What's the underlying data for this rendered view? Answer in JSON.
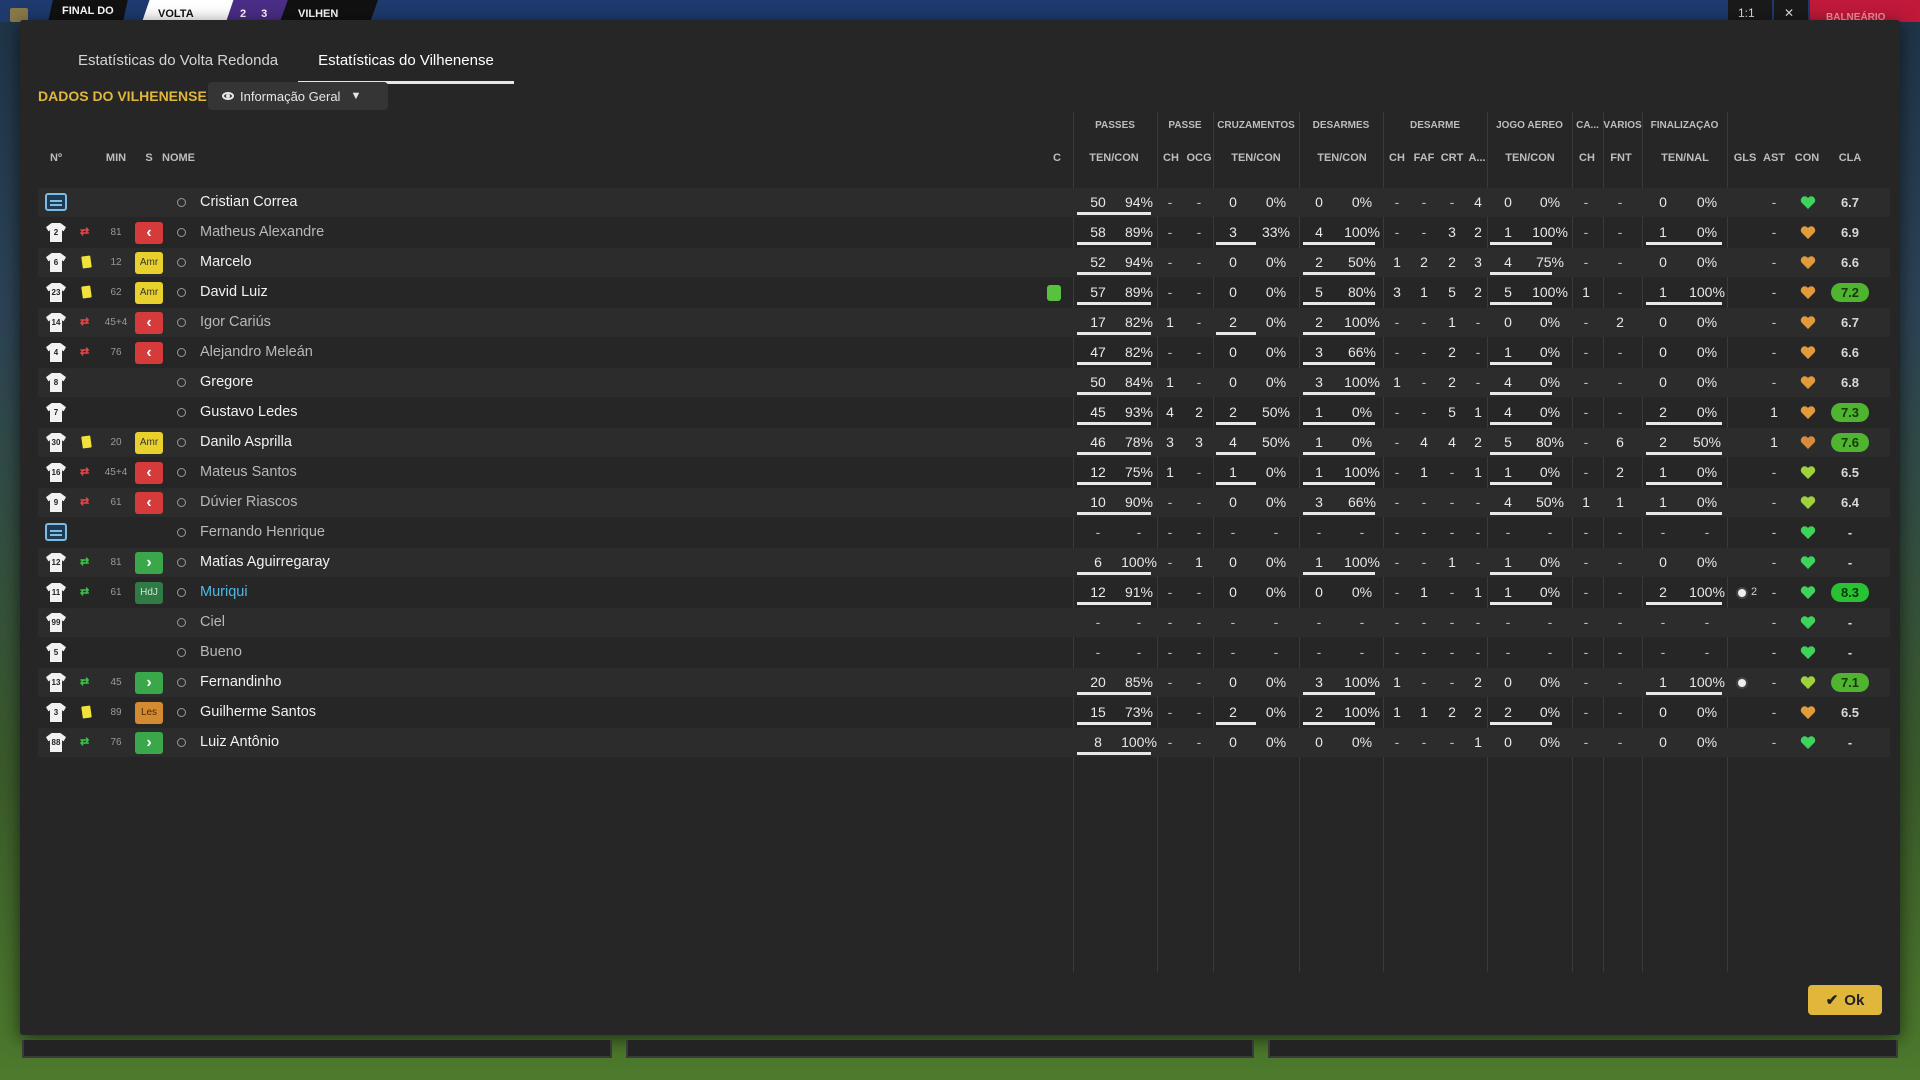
{
  "scoreboard": {
    "status": "FINAL DO",
    "home": "VOLTA",
    "score": "2 3",
    "away": "VILHEN",
    "controls": [
      "1:1",
      "✕"
    ],
    "balneario": "BALNEÁRIO"
  },
  "tabs": [
    {
      "label": "Estatísticas do Volta Redonda",
      "active": false
    },
    {
      "label": "Estatísticas do Vilhenense",
      "active": true
    }
  ],
  "section_title": "DADOS DO VILHENENSE",
  "view_dropdown": "Informação Geral",
  "group_headers": [
    "PASSES",
    "PASSE",
    "CRUZAMENTOS",
    "DESARMES",
    "DESARME",
    "JOGO AÉREO",
    "CA...",
    "VÁRIOS",
    "FINALIZAÇÃO"
  ],
  "col_headers": {
    "num": "Nº",
    "min": "MIN",
    "s": "S",
    "nome": "NOME",
    "c": "C",
    "passes": "TEN/CON",
    "passe_ch": "CH",
    "passe_ocg": "OCG",
    "cruz": "TEN/CON",
    "desarmes": "TEN/CON",
    "des_ch": "CH",
    "des_faf": "FAF",
    "des_crt": "CRT",
    "des_a": "A...",
    "aereo": "TEN/CON",
    "ca_ch": "CH",
    "fnt": "FNT",
    "fin": "TEN/NAL",
    "gls": "GLS",
    "ast": "AST",
    "con": "CON",
    "cla": "CLA"
  },
  "players": [
    {
      "num": "",
      "bench": true,
      "ev": "",
      "min": "",
      "st": "",
      "name": "Cristian Correa",
      "style": "normal",
      "fit": false,
      "pass": [
        "50",
        "94%"
      ],
      "pch": "-",
      "pocg": "-",
      "cruz": [
        "0",
        "0%"
      ],
      "des": [
        "0",
        "0%"
      ],
      "dch": "-",
      "dfaf": "-",
      "dcrt": "-",
      "da": "4",
      "aer": [
        "0",
        "0%"
      ],
      "cach": "-",
      "fnt": "-",
      "fin": [
        "0",
        "0%"
      ],
      "gls": "",
      "ast": "-",
      "con": "green",
      "cla": "6.7",
      "cla_style": "plain"
    },
    {
      "num": "2",
      "ev": "out",
      "min": "81",
      "st": "out",
      "name": "Matheus Alexandre",
      "style": "dim",
      "fit": false,
      "pass": [
        "58",
        "89%"
      ],
      "pch": "-",
      "pocg": "-",
      "cruz": [
        "3",
        "33%"
      ],
      "des": [
        "4",
        "100%"
      ],
      "dch": "-",
      "dfaf": "-",
      "dcrt": "3",
      "da": "2",
      "aer": [
        "1",
        "100%"
      ],
      "cach": "-",
      "fnt": "-",
      "fin": [
        "1",
        "0%"
      ],
      "gls": "",
      "ast": "-",
      "con": "orange",
      "cla": "6.9",
      "cla_style": "plain"
    },
    {
      "num": "6",
      "ev": "yellow",
      "min": "12",
      "st": "Amr",
      "name": "Marcelo",
      "style": "normal",
      "fit": false,
      "pass": [
        "52",
        "94%"
      ],
      "pch": "-",
      "pocg": "-",
      "cruz": [
        "0",
        "0%"
      ],
      "des": [
        "2",
        "50%"
      ],
      "dch": "1",
      "dfaf": "2",
      "dcrt": "2",
      "da": "3",
      "aer": [
        "4",
        "75%"
      ],
      "cach": "-",
      "fnt": "-",
      "fin": [
        "0",
        "0%"
      ],
      "gls": "",
      "ast": "-",
      "con": "orange",
      "cla": "6.6",
      "cla_style": "plain"
    },
    {
      "num": "23",
      "ev": "yellow",
      "min": "62",
      "st": "Amr",
      "name": "David Luiz",
      "style": "normal",
      "fit": true,
      "pass": [
        "57",
        "89%"
      ],
      "pch": "-",
      "pocg": "-",
      "cruz": [
        "0",
        "0%"
      ],
      "des": [
        "5",
        "80%"
      ],
      "dch": "3",
      "dfaf": "1",
      "dcrt": "5",
      "da": "2",
      "aer": [
        "5",
        "100%"
      ],
      "cach": "1",
      "fnt": "-",
      "fin": [
        "1",
        "100%"
      ],
      "gls": "",
      "ast": "-",
      "con": "orange",
      "cla": "7.2",
      "cla_style": "good"
    },
    {
      "num": "14",
      "ev": "out",
      "min": "45+4",
      "st": "out",
      "name": "Igor Cariús",
      "style": "dim",
      "fit": false,
      "pass": [
        "17",
        "82%"
      ],
      "pch": "1",
      "pocg": "-",
      "cruz": [
        "2",
        "0%"
      ],
      "des": [
        "2",
        "100%"
      ],
      "dch": "-",
      "dfaf": "-",
      "dcrt": "1",
      "da": "-",
      "aer": [
        "0",
        "0%"
      ],
      "cach": "-",
      "fnt": "2",
      "fin": [
        "0",
        "0%"
      ],
      "gls": "",
      "ast": "-",
      "con": "orange",
      "cla": "6.7",
      "cla_style": "plain"
    },
    {
      "num": "4",
      "ev": "out",
      "min": "76",
      "st": "out",
      "name": "Alejandro Meleán",
      "style": "dim",
      "fit": false,
      "pass": [
        "47",
        "82%"
      ],
      "pch": "-",
      "pocg": "-",
      "cruz": [
        "0",
        "0%"
      ],
      "des": [
        "3",
        "66%"
      ],
      "dch": "-",
      "dfaf": "-",
      "dcrt": "2",
      "da": "-",
      "aer": [
        "1",
        "0%"
      ],
      "cach": "-",
      "fnt": "-",
      "fin": [
        "0",
        "0%"
      ],
      "gls": "",
      "ast": "-",
      "con": "orange",
      "cla": "6.6",
      "cla_style": "plain"
    },
    {
      "num": "8",
      "ev": "",
      "min": "",
      "st": "",
      "name": "Gregore",
      "style": "normal",
      "fit": false,
      "pass": [
        "50",
        "84%"
      ],
      "pch": "1",
      "pocg": "-",
      "cruz": [
        "0",
        "0%"
      ],
      "des": [
        "3",
        "100%"
      ],
      "dch": "1",
      "dfaf": "-",
      "dcrt": "2",
      "da": "-",
      "aer": [
        "4",
        "0%"
      ],
      "cach": "-",
      "fnt": "-",
      "fin": [
        "0",
        "0%"
      ],
      "gls": "",
      "ast": "-",
      "con": "orange",
      "cla": "6.8",
      "cla_style": "plain"
    },
    {
      "num": "7",
      "ev": "",
      "min": "",
      "st": "",
      "name": "Gustavo Ledes",
      "style": "normal",
      "fit": false,
      "pass": [
        "45",
        "93%"
      ],
      "pch": "4",
      "pocg": "2",
      "cruz": [
        "2",
        "50%"
      ],
      "des": [
        "1",
        "0%"
      ],
      "dch": "-",
      "dfaf": "-",
      "dcrt": "5",
      "da": "1",
      "aer": [
        "4",
        "0%"
      ],
      "cach": "-",
      "fnt": "-",
      "fin": [
        "2",
        "0%"
      ],
      "gls": "",
      "ast": "1",
      "con": "orange",
      "cla": "7.3",
      "cla_style": "good"
    },
    {
      "num": "30",
      "ev": "yellow",
      "min": "20",
      "st": "Amr",
      "name": "Danilo Asprilla",
      "style": "normal",
      "fit": false,
      "pass": [
        "46",
        "78%"
      ],
      "pch": "3",
      "pocg": "3",
      "cruz": [
        "4",
        "50%"
      ],
      "des": [
        "1",
        "0%"
      ],
      "dch": "-",
      "dfaf": "4",
      "dcrt": "4",
      "da": "2",
      "aer": [
        "5",
        "80%"
      ],
      "cach": "-",
      "fnt": "6",
      "fin": [
        "2",
        "50%"
      ],
      "gls": "",
      "ast": "1",
      "con": "orange2",
      "cla": "7.6",
      "cla_style": "good"
    },
    {
      "num": "16",
      "ev": "out",
      "min": "45+4",
      "st": "out",
      "name": "Mateus Santos",
      "style": "dim",
      "fit": false,
      "pass": [
        "12",
        "75%"
      ],
      "pch": "1",
      "pocg": "-",
      "cruz": [
        "1",
        "0%"
      ],
      "des": [
        "1",
        "100%"
      ],
      "dch": "-",
      "dfaf": "1",
      "dcrt": "-",
      "da": "1",
      "aer": [
        "1",
        "0%"
      ],
      "cach": "-",
      "fnt": "2",
      "fin": [
        "1",
        "0%"
      ],
      "gls": "",
      "ast": "-",
      "con": "lime",
      "cla": "6.5",
      "cla_style": "plain"
    },
    {
      "num": "9",
      "ev": "out",
      "min": "61",
      "st": "out",
      "name": "Dúvier Riascos",
      "style": "dim",
      "fit": false,
      "pass": [
        "10",
        "90%"
      ],
      "pch": "-",
      "pocg": "-",
      "cruz": [
        "0",
        "0%"
      ],
      "des": [
        "3",
        "66%"
      ],
      "dch": "-",
      "dfaf": "-",
      "dcrt": "-",
      "da": "-",
      "aer": [
        "4",
        "50%"
      ],
      "cach": "1",
      "fnt": "1",
      "fin": [
        "1",
        "0%"
      ],
      "gls": "",
      "ast": "-",
      "con": "lime",
      "cla": "6.4",
      "cla_style": "plain"
    },
    {
      "num": "",
      "bench": true,
      "ev": "",
      "min": "",
      "st": "",
      "name": "Fernando Henrique",
      "style": "dim",
      "fit": false,
      "pass": [
        "-",
        "-"
      ],
      "pch": "-",
      "pocg": "-",
      "cruz": [
        "-",
        "-"
      ],
      "des": [
        "-",
        "-"
      ],
      "dch": "-",
      "dfaf": "-",
      "dcrt": "-",
      "da": "-",
      "aer": [
        "-",
        "-"
      ],
      "cach": "-",
      "fnt": "-",
      "fin": [
        "-",
        "-"
      ],
      "gls": "",
      "ast": "-",
      "con": "green",
      "cla": "-",
      "cla_style": "plain"
    },
    {
      "num": "12",
      "ev": "in",
      "min": "81",
      "st": "in",
      "name": "Matías Aguirregaray",
      "style": "normal",
      "fit": false,
      "pass": [
        "6",
        "100%"
      ],
      "pch": "-",
      "pocg": "1",
      "cruz": [
        "0",
        "0%"
      ],
      "des": [
        "1",
        "100%"
      ],
      "dch": "-",
      "dfaf": "-",
      "dcrt": "1",
      "da": "-",
      "aer": [
        "1",
        "0%"
      ],
      "cach": "-",
      "fnt": "-",
      "fin": [
        "0",
        "0%"
      ],
      "gls": "",
      "ast": "-",
      "con": "green",
      "cla": "-",
      "cla_style": "plain"
    },
    {
      "num": "11",
      "ev": "in",
      "min": "61",
      "st": "HdJ",
      "name": "Muriqui",
      "style": "link",
      "fit": false,
      "pass": [
        "12",
        "91%"
      ],
      "pch": "-",
      "pocg": "-",
      "cruz": [
        "0",
        "0%"
      ],
      "des": [
        "0",
        "0%"
      ],
      "dch": "-",
      "dfaf": "1",
      "dcrt": "-",
      "da": "1",
      "aer": [
        "1",
        "0%"
      ],
      "cach": "-",
      "fnt": "-",
      "fin": [
        "2",
        "100%"
      ],
      "gls": "2",
      "ast": "-",
      "con": "green",
      "cla": "8.3",
      "cla_style": "great"
    },
    {
      "num": "99",
      "ev": "",
      "min": "",
      "st": "",
      "name": "Ciel",
      "style": "dim",
      "fit": false,
      "pass": [
        "-",
        "-"
      ],
      "pch": "-",
      "pocg": "-",
      "cruz": [
        "-",
        "-"
      ],
      "des": [
        "-",
        "-"
      ],
      "dch": "-",
      "dfaf": "-",
      "dcrt": "-",
      "da": "-",
      "aer": [
        "-",
        "-"
      ],
      "cach": "-",
      "fnt": "-",
      "fin": [
        "-",
        "-"
      ],
      "gls": "",
      "ast": "-",
      "con": "green",
      "cla": "-",
      "cla_style": "plain"
    },
    {
      "num": "5",
      "ev": "",
      "min": "",
      "st": "",
      "name": "Bueno",
      "style": "dim",
      "fit": false,
      "pass": [
        "-",
        "-"
      ],
      "pch": "-",
      "pocg": "-",
      "cruz": [
        "-",
        "-"
      ],
      "des": [
        "-",
        "-"
      ],
      "dch": "-",
      "dfaf": "-",
      "dcrt": "-",
      "da": "-",
      "aer": [
        "-",
        "-"
      ],
      "cach": "-",
      "fnt": "-",
      "fin": [
        "-",
        "-"
      ],
      "gls": "",
      "ast": "-",
      "con": "green",
      "cla": "-",
      "cla_style": "plain"
    },
    {
      "num": "13",
      "ev": "in",
      "min": "45",
      "st": "in",
      "name": "Fernandinho",
      "style": "normal",
      "fit": false,
      "pass": [
        "20",
        "85%"
      ],
      "pch": "-",
      "pocg": "-",
      "cruz": [
        "0",
        "0%"
      ],
      "des": [
        "3",
        "100%"
      ],
      "dch": "1",
      "dfaf": "-",
      "dcrt": "-",
      "da": "2",
      "aer": [
        "0",
        "0%"
      ],
      "cach": "-",
      "fnt": "-",
      "fin": [
        "1",
        "100%"
      ],
      "gls": "1",
      "ast": "-",
      "con": "lime",
      "cla": "7.1",
      "cla_style": "good"
    },
    {
      "num": "3",
      "ev": "yellow",
      "min": "89",
      "st": "Les",
      "name": "Guilherme Santos",
      "style": "normal",
      "fit": false,
      "pass": [
        "15",
        "73%"
      ],
      "pch": "-",
      "pocg": "-",
      "cruz": [
        "2",
        "0%"
      ],
      "des": [
        "2",
        "100%"
      ],
      "dch": "1",
      "dfaf": "1",
      "dcrt": "2",
      "da": "2",
      "aer": [
        "2",
        "0%"
      ],
      "cach": "-",
      "fnt": "-",
      "fin": [
        "0",
        "0%"
      ],
      "gls": "",
      "ast": "-",
      "con": "orange",
      "cla": "6.5",
      "cla_style": "plain"
    },
    {
      "num": "88",
      "ev": "in",
      "min": "76",
      "st": "in",
      "name": "Luiz Antônio",
      "style": "normal",
      "fit": false,
      "pass": [
        "8",
        "100%"
      ],
      "pch": "-",
      "pocg": "-",
      "cruz": [
        "0",
        "0%"
      ],
      "des": [
        "0",
        "0%"
      ],
      "dch": "-",
      "dfaf": "-",
      "dcrt": "-",
      "da": "1",
      "aer": [
        "0",
        "0%"
      ],
      "cach": "-",
      "fnt": "-",
      "fin": [
        "0",
        "0%"
      ],
      "gls": "",
      "ast": "-",
      "con": "green",
      "cla": "-",
      "cla_style": "plain"
    }
  ],
  "ok_label": "Ok",
  "colors": {
    "accent": "#e0b63b",
    "link": "#4fb8e6",
    "card_yellow": "#f2e13a",
    "sub_out": "#d63b3b",
    "sub_in": "#3aa84a"
  }
}
